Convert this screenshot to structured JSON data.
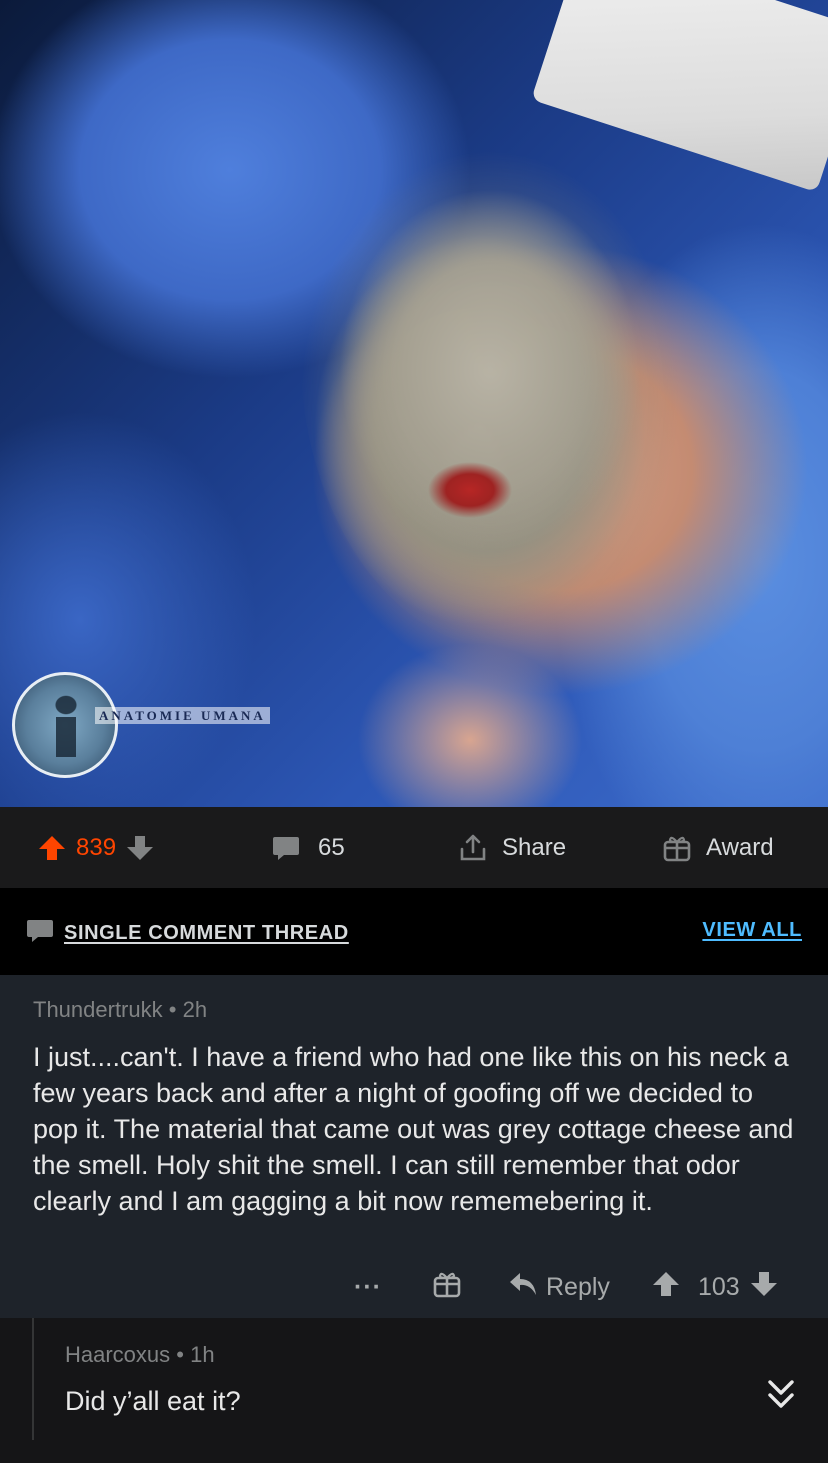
{
  "post": {
    "media_watermark": "ANATOMIE UMANA",
    "vote_count": "839",
    "comment_count": "65",
    "share_label": "Share",
    "award_label": "Award"
  },
  "thread": {
    "single_label": "SINGLE COMMENT THREAD",
    "view_all_label": "VIEW ALL"
  },
  "comments": [
    {
      "author": "Thundertrukk",
      "time": "2h",
      "body": "I just....can't. I have a friend who had one like this on his neck a few years back and after a night of goofing off we decided to pop it. The material that came out was grey cottage cheese and the smell. Holy shit the smell. I can still remember that odor clearly and I am gagging a bit now rememebering it.",
      "more_label": "···",
      "reply_label": "Reply",
      "score": "103"
    },
    {
      "author": "Haarcoxus",
      "time": "1h",
      "body": "Did y’all eat it?"
    }
  ],
  "colors": {
    "upvote": "#ff4500",
    "link": "#4fbcff",
    "comment_bg": "#1e232a"
  }
}
